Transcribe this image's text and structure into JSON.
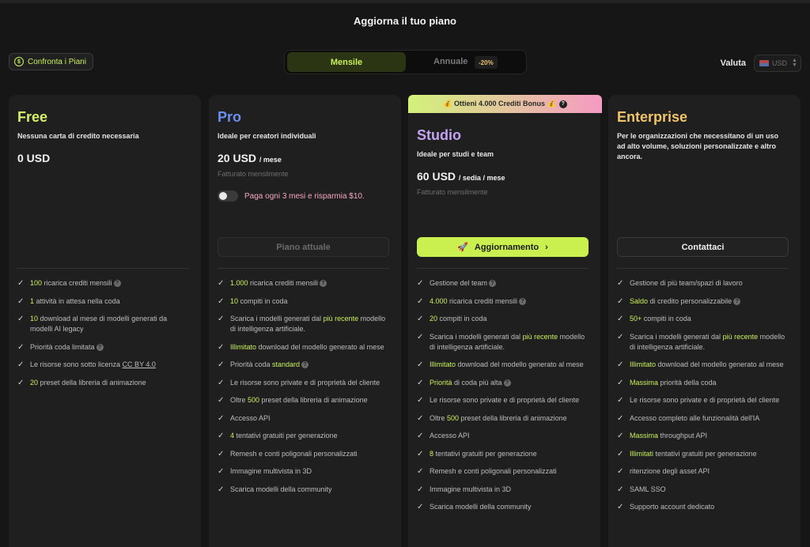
{
  "header": {
    "title": "Aggiorna il tuo piano"
  },
  "compare_button": {
    "label": "Confronta i Piani",
    "icon": "coin-icon"
  },
  "billing_toggle": {
    "monthly": "Mensile",
    "annual": "Annuale",
    "discount": "-20%"
  },
  "currency": {
    "label": "Valuta",
    "selected": "USD"
  },
  "bonus_banner": {
    "text": "💰 Ottieni 4.000 Crediti Bonus 💰",
    "info": "?"
  },
  "colors": {
    "accent": "#c9f05a",
    "free": "#d6f06a",
    "pro": "#6e8ff0",
    "studio": "#c4a4f2",
    "enterprise": "#f0c56a"
  },
  "plans": {
    "free": {
      "name": "Free",
      "description": "Nessuna carta di credito necessaria",
      "price": "0 USD",
      "features": [
        {
          "hl": "100",
          "text": " ricarica crediti mensili",
          "q": true
        },
        {
          "hl": "1",
          "text": " attività in attesa nella coda"
        },
        {
          "hl": "10",
          "text": " download al mese di modelli generati da modelli AI legacy"
        },
        {
          "text": "Priorità coda limitata",
          "q": true
        },
        {
          "text": "Le risorse sono sotto licenza ",
          "link": "CC BY 4.0"
        },
        {
          "hl": "20",
          "text": " preset della libreria di animazione"
        }
      ]
    },
    "pro": {
      "name": "Pro",
      "description": "Ideale per creatori individuali",
      "price": "20 USD",
      "price_unit": "/ mese",
      "billing": "Fatturato mensilmente",
      "quarterly": "Paga ogni 3 mesi e risparmia $10.",
      "cta": "Piano attuale",
      "features": [
        {
          "hl": "1.000",
          "text": " ricarica crediti mensili",
          "q": true
        },
        {
          "hl": "10",
          "text": " compiti in coda"
        },
        {
          "pre": "Scarica i modelli generati dal ",
          "hl": "più recente",
          "text": " modello di intelligenza artificiale."
        },
        {
          "hl": "Illimitato",
          "text": " download del modello generato al mese"
        },
        {
          "pre": "Priorità coda ",
          "hl": "standard",
          "text": "",
          "q": true
        },
        {
          "text": "Le risorse sono private e di proprietà del cliente"
        },
        {
          "pre": "Oltre ",
          "hl": "500",
          "text": " preset della libreria di animazione"
        },
        {
          "text": "Accesso API"
        },
        {
          "hl": "4",
          "text": " tentativi gratuiti per generazione"
        },
        {
          "text": "Remesh e conti poligonali personalizzati"
        },
        {
          "text": "Immagine multivista in 3D"
        },
        {
          "text": "Scarica modelli della community"
        }
      ]
    },
    "studio": {
      "name": "Studio",
      "description": "Ideale per studi e team",
      "price": "60 USD",
      "price_unit": "/ sedia / mese",
      "billing": "Fatturato mensilmente",
      "cta": "Aggiornamento",
      "features": [
        {
          "text": "Gestione del team",
          "q": true
        },
        {
          "hl": "4.000",
          "text": " ricarica crediti mensili",
          "q": true
        },
        {
          "hl": "20",
          "text": " compiti in coda"
        },
        {
          "pre": "Scarica i modelli generati dal ",
          "hl": "più recente",
          "text": " modello di intelligenza artificiale."
        },
        {
          "hl": "Illimitato",
          "text": " download del modello generato al mese"
        },
        {
          "hl": "Priorità",
          "text": " di coda più alta",
          "q": true
        },
        {
          "text": "Le risorse sono private e di proprietà del cliente"
        },
        {
          "pre": "Oltre ",
          "hl": "500",
          "text": " preset della libreria di animazione"
        },
        {
          "text": "Accesso API"
        },
        {
          "hl": "8",
          "text": " tentativi gratuiti per generazione"
        },
        {
          "text": "Remesh e conti poligonali personalizzati"
        },
        {
          "text": "Immagine multivista in 3D"
        },
        {
          "text": "Scarica modelli della community"
        }
      ]
    },
    "enterprise": {
      "name": "Enterprise",
      "description": "Per le organizzazioni che necessitano di un uso ad alto volume, soluzioni personalizzate e altro ancora.",
      "cta": "Contattaci",
      "features": [
        {
          "text": "Gestione di più team/spazi di lavoro"
        },
        {
          "hl": "Saldo",
          "text": " di credito personalizzabile",
          "q": true
        },
        {
          "hl": "50+",
          "text": " compiti in coda"
        },
        {
          "pre": "Scarica i modelli generati dal ",
          "hl": "più recente",
          "text": " modello di intelligenza artificiale."
        },
        {
          "hl": "Illimitato",
          "text": " download del modello generato al mese"
        },
        {
          "hl": "Massima",
          "text": " priorità della coda"
        },
        {
          "text": "Le risorse sono private e di proprietà del cliente"
        },
        {
          "text": "Accesso completo alle funzionalità dell'IA"
        },
        {
          "hl": "Massima",
          "text": " throughput API"
        },
        {
          "hl": "Illimitati",
          "text": " tentativi gratuiti per generazione"
        },
        {
          "text": "ritenzione degli asset API"
        },
        {
          "text": "SAML SSO"
        },
        {
          "text": "Supporto account dedicato"
        }
      ]
    }
  }
}
